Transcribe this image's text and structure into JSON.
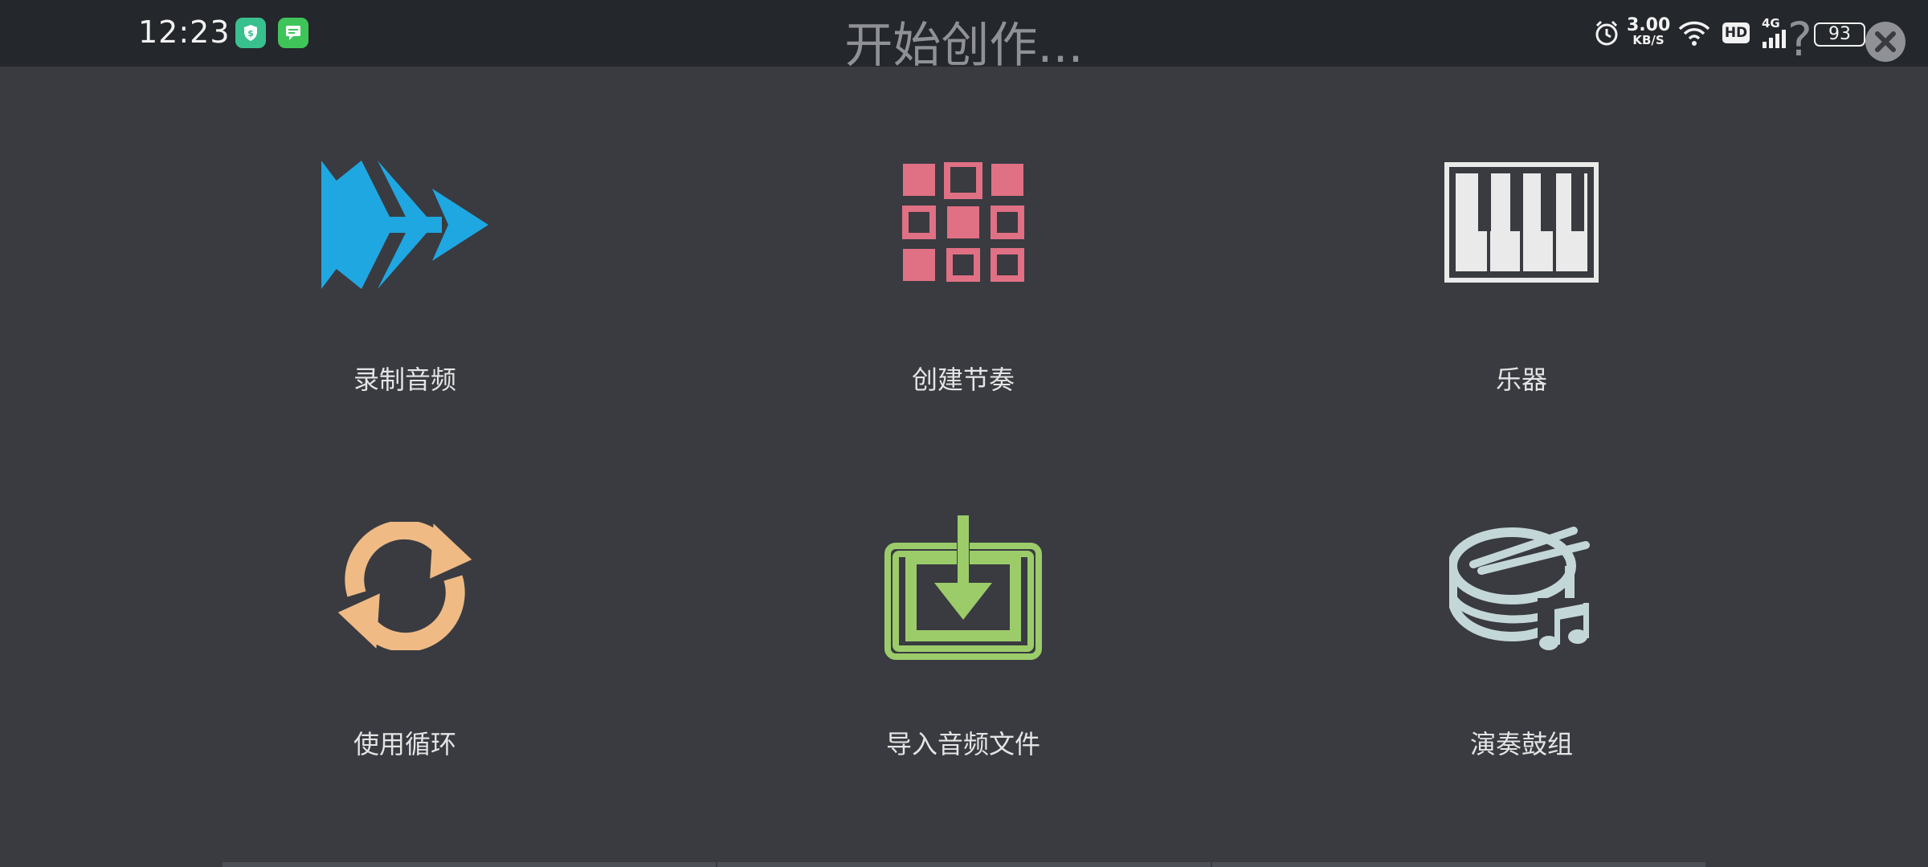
{
  "status_bar": {
    "time": "12:23",
    "net_speed_value": "3.00",
    "net_speed_unit": "KB/S",
    "hd_badge": "HD",
    "network_type": "4G",
    "battery_level": "93"
  },
  "header": {
    "title": "开始创作...",
    "help_label": "?"
  },
  "tiles": [
    {
      "label": "录制音频",
      "icon": "fast-forward-icon",
      "color": "#1fa7e2"
    },
    {
      "label": "创建节奏",
      "icon": "drum-pad-grid-icon",
      "color": "#e07084"
    },
    {
      "label": "乐器",
      "icon": "piano-keys-icon",
      "color": "#eaeaea"
    },
    {
      "label": "使用循环",
      "icon": "loop-arrows-icon",
      "color": "#efba84"
    },
    {
      "label": "导入音频文件",
      "icon": "import-download-icon",
      "color": "#9ccc6a"
    },
    {
      "label": "演奏鼓组",
      "icon": "drum-kit-icon",
      "color": "#c4d7d8"
    }
  ]
}
